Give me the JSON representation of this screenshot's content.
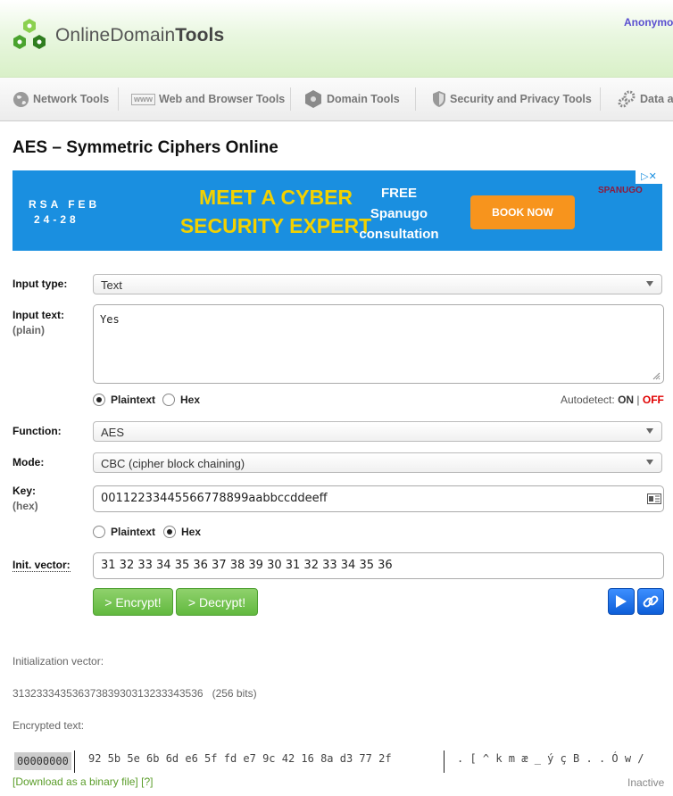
{
  "header": {
    "brand_light": "Online",
    "brand_mid": "Domain",
    "brand_bold": "Tools",
    "user": "Anonymous"
  },
  "nav": [
    {
      "label": "Network Tools",
      "icon": "globe-icon"
    },
    {
      "label": "Web and Browser Tools",
      "icon": "www-icon"
    },
    {
      "label": "Domain Tools",
      "icon": "hexagon-icon"
    },
    {
      "label": "Security and Privacy Tools",
      "icon": "shield-icon"
    },
    {
      "label": "Data and",
      "icon": "gears-icon"
    }
  ],
  "page": {
    "title": "AES – Symmetric Ciphers Online"
  },
  "ad": {
    "date1": "RSA FEB",
    "date2": "24-28",
    "headline1": "MEET A CYBER",
    "headline2": "SECURITY EXPERT",
    "free1": "FREE",
    "free2": "Spanugo",
    "free3": "consultation",
    "cta": "BOOK NOW",
    "sponsor": "SPANUGO"
  },
  "form": {
    "input_type_label": "Input type:",
    "input_type_value": "Text",
    "input_text_label": "Input text:",
    "input_text_sub": "(plain)",
    "input_text_value": "Yes",
    "opt_plaintext": "Plaintext",
    "opt_hex": "Hex",
    "autodetect_label": "Autodetect:",
    "autodetect_on": "ON",
    "autodetect_sep": "|",
    "autodetect_off": "OFF",
    "function_label": "Function:",
    "function_value": "AES",
    "mode_label": "Mode:",
    "mode_value": "CBC (cipher block chaining)",
    "key_label": "Key:",
    "key_sub": "(hex)",
    "key_value": "00112233445566778899aabbccddeeff",
    "iv_label": "Init. vector:",
    "iv_value": "31 32 33 34 35 36 37 38 39 30 31 32 33 34 35 36",
    "encrypt_label": "> Encrypt!",
    "decrypt_label": "> Decrypt!",
    "colors": {
      "accent_green": "#62b93f",
      "blue_btn": "#0d5ed8",
      "off_red": "#e00000"
    }
  },
  "output": {
    "iv_title": "Initialization vector:",
    "iv_hex": "31323334353637383930313233343536",
    "iv_bits": "(256 bits)",
    "enc_title": "Encrypted text:",
    "offset": "00000000",
    "hex_bytes": "92 5b 5e 6b 6d e6 5f fd e7 9c 42 16 8a d3 77 2f",
    "ascii": ". [ ^ k m æ _ ý ç  B . . Ó w /",
    "download": "Download as a binary file",
    "help": "?",
    "status": "Inactive"
  }
}
